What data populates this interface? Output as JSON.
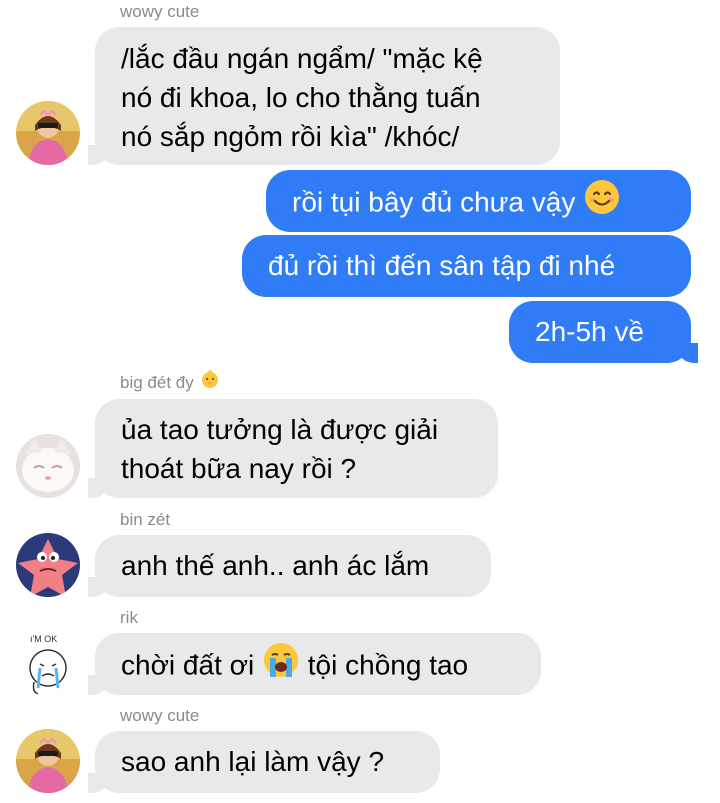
{
  "messages": [
    {
      "sender": "wowy cute",
      "text": "/lắc đầu ngán ngẩm/ \"mặc kệ",
      "text2": "nó đi khoa, lo cho thằng tuấn",
      "text3": "nó sắp ngỏm rồi kìa\" /khóc/"
    },
    {
      "text": "rồi tụi bây đủ chưa vậy"
    },
    {
      "text": "đủ rồi thì đến sân tập đi nhé"
    },
    {
      "text": "2h-5h về"
    },
    {
      "sender": "big đét đy",
      "text": "ủa tao tưởng là được giải",
      "text2": "thoát bữa nay rồi ?"
    },
    {
      "sender": "bin zét",
      "text": "anh thế anh.. anh ác lắm"
    },
    {
      "sender": "rik",
      "text_before": "chời đất ơi",
      "text_after": "tội chồng tao",
      "avatar_text": "I'M OK"
    },
    {
      "sender": "wowy cute",
      "text": "sao anh lại làm vậy ?"
    }
  ],
  "icons": {
    "smile": "smiling-face-emoji",
    "baby": "baby-emoji",
    "cry": "loudly-crying-face-emoji"
  },
  "colors": {
    "outgoing": "#2f7cf6",
    "incoming": "#e9e9eb",
    "sender": "#8a8a8e"
  }
}
